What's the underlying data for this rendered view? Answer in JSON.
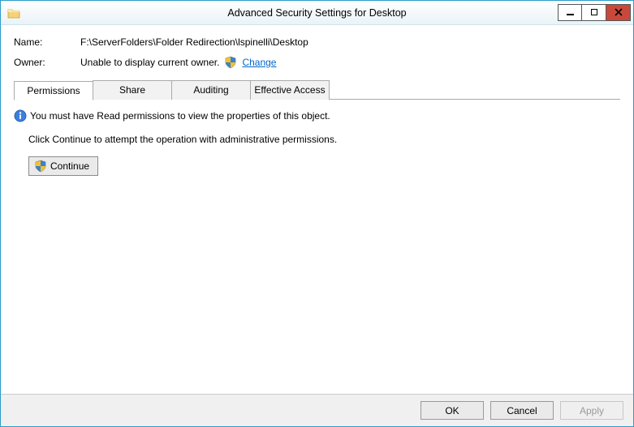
{
  "window": {
    "title": "Advanced Security Settings for Desktop"
  },
  "info": {
    "name_label": "Name:",
    "name_value": "F:\\ServerFolders\\Folder Redirection\\lspinelli\\Desktop",
    "owner_label": "Owner:",
    "owner_value": "Unable to display current owner.",
    "change_link": "Change"
  },
  "tabs": {
    "permissions": "Permissions",
    "share": "Share",
    "auditing": "Auditing",
    "effective": "Effective Access"
  },
  "panel": {
    "info_msg": "You must have Read permissions to view the properties of this object.",
    "continue_msg": "Click Continue to attempt the operation with administrative permissions.",
    "continue_btn": "Continue"
  },
  "footer": {
    "ok": "OK",
    "cancel": "Cancel",
    "apply": "Apply"
  }
}
